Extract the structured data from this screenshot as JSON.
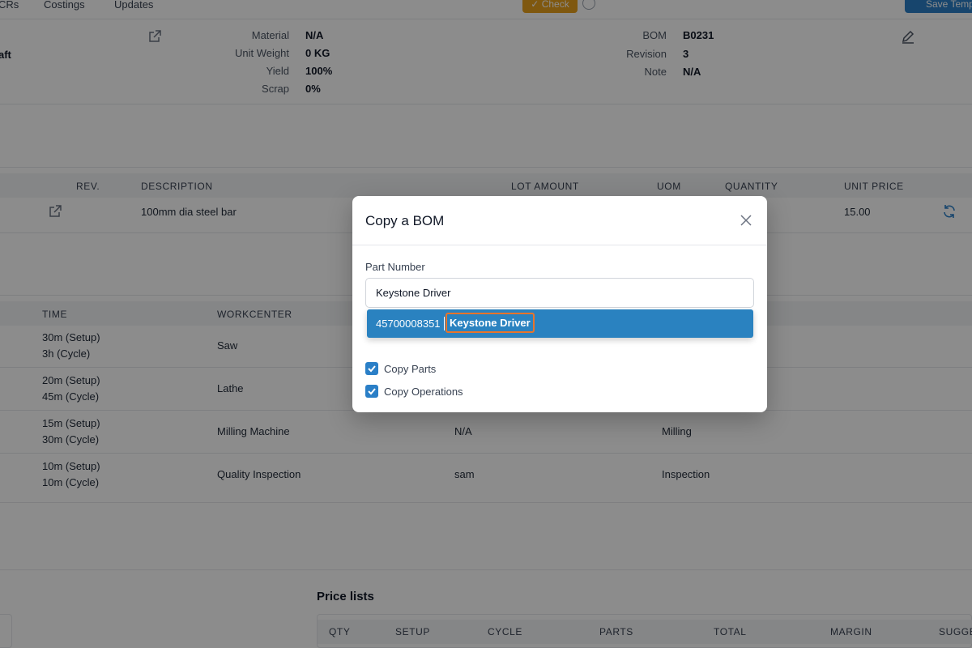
{
  "tabs": [
    "CRs",
    "Costings",
    "Updates"
  ],
  "toolbar": {
    "check_label": "Check",
    "save_label": "Save Temp"
  },
  "details": {
    "left_partial": "aft",
    "material_label": "Material",
    "material": "N/A",
    "unit_weight_label": "Unit Weight",
    "unit_weight": "0 KG",
    "yield_label": "Yield",
    "yield": "100%",
    "scrap_label": "Scrap",
    "scrap": "0%",
    "bom_label": "BOM",
    "bom": "B0231",
    "revision_label": "Revision",
    "revision": "3",
    "note_label": "Note",
    "note": "N/A"
  },
  "parts_table": {
    "headers": [
      "REV.",
      "DESCRIPTION",
      "LOT AMOUNT",
      "UOM",
      "QUANTITY",
      "UNIT PRICE"
    ],
    "rows": [
      {
        "description": "100mm dia steel bar",
        "unit_price": "15.00"
      }
    ]
  },
  "ops_table": {
    "headers": [
      "TIME",
      "WORKCENTER"
    ],
    "rows": [
      {
        "setup": "30m (Setup)",
        "cycle": "3h (Cycle)",
        "workcenter": "Saw",
        "col3": "",
        "col4": ""
      },
      {
        "setup": "20m (Setup)",
        "cycle": "45m (Cycle)",
        "workcenter": "Lathe",
        "col3": "",
        "col4": ""
      },
      {
        "setup": "15m (Setup)",
        "cycle": "30m (Cycle)",
        "workcenter": "Milling Machine",
        "col3": "N/A",
        "col4": "Milling"
      },
      {
        "setup": "10m (Setup)",
        "cycle": "10m (Cycle)",
        "workcenter": "Quality Inspection",
        "col3": "sam",
        "col4": "Inspection"
      }
    ]
  },
  "price_lists": {
    "title": "Price lists",
    "headers": [
      "QTY",
      "SETUP",
      "CYCLE",
      "PARTS",
      "TOTAL",
      "MARGIN",
      "SUGGE"
    ]
  },
  "modal": {
    "title": "Copy a BOM",
    "part_number_label": "Part Number",
    "part_number_value": "Keystone Driver",
    "option_code": "45700008351",
    "option_name": "Keystone Driver",
    "copy_parts_label": "Copy Parts",
    "copy_operations_label": "Copy Operations",
    "copy_parts_checked": true,
    "copy_operations_checked": true
  },
  "colors": {
    "primary": "#2a7fc7",
    "warning": "#e8a01c",
    "highlight": "#e8742a"
  }
}
